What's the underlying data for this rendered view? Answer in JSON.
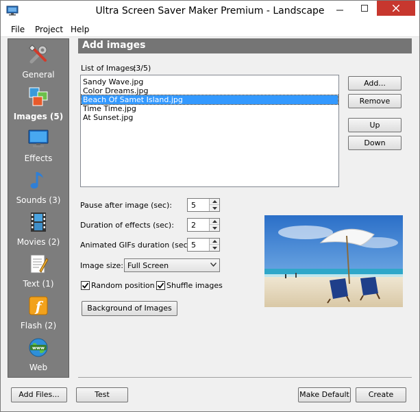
{
  "window": {
    "title": "Ultra Screen Saver Maker Premium - Landscape",
    "controls": {
      "minimize": "–",
      "maximize": "□",
      "close": "✕"
    }
  },
  "menu": [
    "File",
    "Project",
    "Help"
  ],
  "sidebar": {
    "items": [
      {
        "label": "General",
        "icon": "tools-icon"
      },
      {
        "label": "Images (5)",
        "icon": "images-icon",
        "active": true
      },
      {
        "label": "Effects",
        "icon": "monitor-icon"
      },
      {
        "label": "Sounds (3)",
        "icon": "music-note-icon"
      },
      {
        "label": "Movies (2)",
        "icon": "film-icon"
      },
      {
        "label": "Text (1)",
        "icon": "document-icon"
      },
      {
        "label": "Flash (2)",
        "icon": "flash-icon"
      },
      {
        "label": "Web",
        "icon": "globe-icon"
      }
    ]
  },
  "section": {
    "title": "Add images",
    "list_label": "List of Images:",
    "list_count": "(3/5)",
    "images": [
      "Sandy Wave.jpg",
      "Color Dreams.jpg",
      "Beach Of Samet Island.jpg",
      "Time Time.jpg",
      "At Sunset.jpg"
    ],
    "selected_index": 2
  },
  "list_buttons": {
    "add": "Add...",
    "remove": "Remove",
    "up": "Up",
    "down": "Down"
  },
  "settings": {
    "pause_label": "Pause after image (sec):",
    "pause_value": "5",
    "duration_label": "Duration of effects (sec):",
    "duration_value": "2",
    "gif_label": "Animated GIFs duration (sec):",
    "gif_value": "5",
    "size_label": "Image size:",
    "size_value": "Full Screen",
    "random_label": "Random position",
    "random_checked": true,
    "shuffle_label": "Shuffle images",
    "shuffle_checked": true,
    "background_button": "Background of Images"
  },
  "footer": {
    "add_files": "Add Files...",
    "test": "Test",
    "make_default": "Make Default",
    "create": "Create"
  },
  "colors": {
    "sidebar_bg": "#7d7d7d",
    "header_bg": "#757575",
    "selection": "#3399ff",
    "close_btn": "#c7372e"
  }
}
